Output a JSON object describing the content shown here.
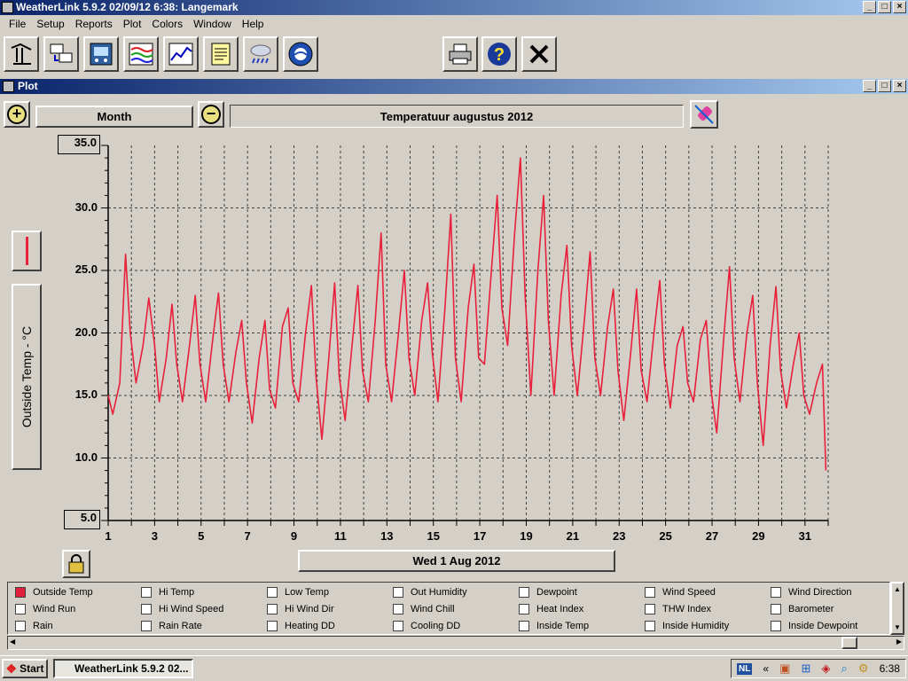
{
  "app": {
    "title": "WeatherLink 5.9.2  02/09/12  6:38: Langemark",
    "menu": [
      "File",
      "Setup",
      "Reports",
      "Plot",
      "Colors",
      "Window",
      "Help"
    ]
  },
  "toolbar_icons": [
    "bulletin-icon",
    "download-icon",
    "station-icon",
    "strip-chart-icon",
    "graph-icon",
    "notepad-icon",
    "rain-icon",
    "noaa-icon",
    "print-icon",
    "help-icon",
    "close-icon"
  ],
  "plot_window": {
    "title": "Plot",
    "span_label": "Month",
    "plot_title": "Temperatuur augustus 2012",
    "variable_label": "Outside Temp - °C",
    "date_label": "Wed 1 Aug 2012",
    "series_color": "#e8203a"
  },
  "chart_data": {
    "type": "line",
    "title": "Temperatuur augustus 2012",
    "xlabel": "",
    "ylabel": "Outside Temp - °C",
    "xlim": [
      1,
      32
    ],
    "ylim": [
      5,
      35
    ],
    "y_ticks": [
      "35.0",
      "30.0",
      "25.0",
      "20.0",
      "15.0",
      "10.0",
      "5.0"
    ],
    "x_ticks": [
      "1",
      "3",
      "5",
      "7",
      "9",
      "11",
      "13",
      "15",
      "17",
      "19",
      "21",
      "23",
      "25",
      "27",
      "29",
      "31"
    ],
    "grid": true,
    "series": [
      {
        "name": "Outside Temp",
        "x": [
          1.0,
          1.2,
          1.5,
          1.75,
          1.95,
          2.2,
          2.5,
          2.75,
          3.0,
          3.2,
          3.5,
          3.75,
          3.95,
          4.2,
          4.5,
          4.75,
          4.95,
          5.2,
          5.5,
          5.75,
          5.95,
          6.2,
          6.5,
          6.75,
          6.95,
          7.2,
          7.5,
          7.75,
          7.95,
          8.2,
          8.5,
          8.75,
          8.95,
          9.2,
          9.5,
          9.75,
          9.95,
          10.2,
          10.5,
          10.75,
          10.95,
          11.2,
          11.5,
          11.75,
          11.95,
          12.2,
          12.5,
          12.75,
          12.95,
          13.2,
          13.5,
          13.75,
          13.95,
          14.2,
          14.5,
          14.75,
          14.95,
          15.2,
          15.5,
          15.75,
          15.95,
          16.2,
          16.5,
          16.75,
          16.95,
          17.2,
          17.5,
          17.75,
          17.95,
          18.2,
          18.5,
          18.75,
          18.95,
          19.2,
          19.5,
          19.75,
          19.95,
          20.2,
          20.5,
          20.75,
          20.95,
          21.2,
          21.5,
          21.75,
          21.95,
          22.2,
          22.5,
          22.75,
          22.95,
          23.2,
          23.5,
          23.75,
          23.95,
          24.2,
          24.5,
          24.75,
          24.95,
          25.2,
          25.5,
          25.75,
          25.95,
          26.2,
          26.5,
          26.75,
          26.95,
          27.2,
          27.5,
          27.75,
          27.95,
          28.2,
          28.5,
          28.75,
          28.95,
          29.2,
          29.5,
          29.75,
          29.95,
          30.2,
          30.5,
          30.75,
          30.95,
          31.2,
          31.5,
          31.75,
          31.9
        ],
        "values": [
          15.0,
          13.5,
          16.0,
          26.3,
          20.0,
          16.0,
          19.0,
          22.8,
          19.0,
          14.5,
          18.0,
          22.3,
          17.5,
          14.5,
          19.0,
          23.0,
          17.5,
          14.5,
          19.5,
          23.2,
          17.5,
          14.5,
          18.5,
          21.0,
          16.0,
          12.8,
          18.0,
          21.0,
          15.5,
          14.0,
          20.5,
          22.0,
          16.0,
          14.5,
          20.0,
          23.8,
          16.5,
          11.5,
          18.0,
          24.0,
          16.5,
          13.0,
          19.0,
          23.8,
          17.0,
          14.5,
          21.0,
          28.0,
          17.5,
          14.5,
          20.0,
          25.0,
          18.0,
          15.0,
          21.0,
          24.0,
          18.5,
          14.5,
          22.0,
          29.5,
          18.0,
          14.5,
          22.0,
          25.5,
          18.0,
          17.5,
          25.0,
          31.0,
          22.0,
          19.0,
          28.0,
          34.0,
          23.0,
          15.0,
          25.0,
          31.0,
          21.0,
          15.0,
          23.0,
          27.0,
          19.0,
          15.0,
          21.0,
          26.5,
          18.0,
          15.0,
          20.5,
          23.5,
          17.0,
          13.0,
          18.5,
          23.5,
          17.0,
          14.5,
          20.0,
          24.2,
          17.5,
          14.0,
          19.0,
          20.5,
          16.0,
          14.5,
          19.5,
          21.0,
          15.5,
          12.0,
          19.5,
          25.3,
          18.0,
          14.5,
          20.0,
          23.0,
          16.0,
          11.0,
          19.0,
          23.7,
          17.0,
          14.0,
          17.5,
          20.0,
          15.0,
          13.5,
          16.0,
          17.5,
          9.0
        ]
      }
    ]
  },
  "legend": {
    "items": [
      {
        "label": "Outside Temp",
        "checked": true
      },
      {
        "label": "Hi Temp",
        "checked": false
      },
      {
        "label": "Low Temp",
        "checked": false
      },
      {
        "label": "Out Humidity",
        "checked": false
      },
      {
        "label": "Dewpoint",
        "checked": false
      },
      {
        "label": "Wind Speed",
        "checked": false
      },
      {
        "label": "Wind Direction",
        "checked": false
      },
      {
        "label": "Wind Run",
        "checked": false
      },
      {
        "label": "Hi Wind Speed",
        "checked": false
      },
      {
        "label": "Hi Wind Dir",
        "checked": false
      },
      {
        "label": "Wind Chill",
        "checked": false
      },
      {
        "label": "Heat Index",
        "checked": false
      },
      {
        "label": "THW Index",
        "checked": false
      },
      {
        "label": "Barometer",
        "checked": false
      },
      {
        "label": "Rain",
        "checked": false
      },
      {
        "label": "Rain Rate",
        "checked": false
      },
      {
        "label": "Heating DD",
        "checked": false
      },
      {
        "label": "Cooling DD",
        "checked": false
      },
      {
        "label": "Inside Temp",
        "checked": false
      },
      {
        "label": "Inside Humidity",
        "checked": false
      },
      {
        "label": "Inside Dewpoint",
        "checked": false
      }
    ]
  },
  "taskbar": {
    "start_label": "Start",
    "task_label": "WeatherLink 5.9.2  02...",
    "lang": "NL",
    "clock": "6:38"
  }
}
